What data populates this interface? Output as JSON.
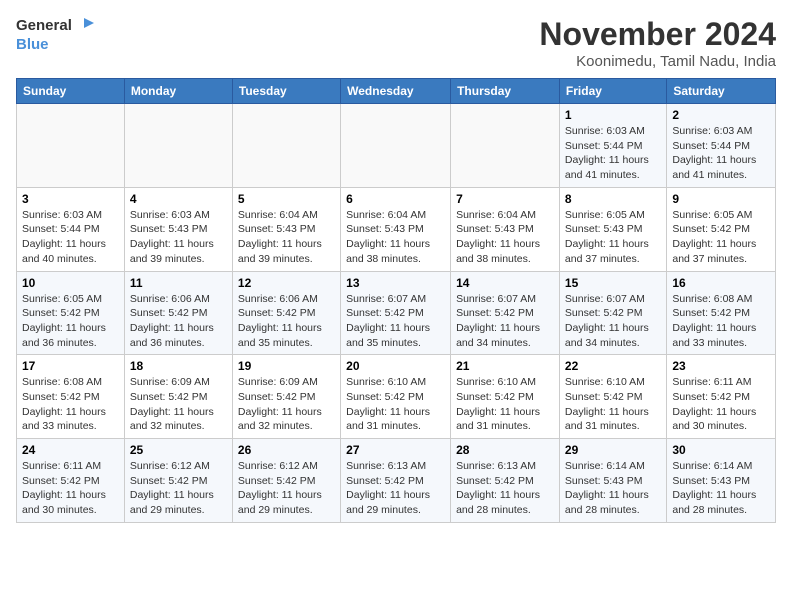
{
  "logo": {
    "text_general": "General",
    "text_blue": "Blue"
  },
  "header": {
    "month_year": "November 2024",
    "location": "Koonimedu, Tamil Nadu, India"
  },
  "weekdays": [
    "Sunday",
    "Monday",
    "Tuesday",
    "Wednesday",
    "Thursday",
    "Friday",
    "Saturday"
  ],
  "weeks": [
    [
      {
        "day": "",
        "info": ""
      },
      {
        "day": "",
        "info": ""
      },
      {
        "day": "",
        "info": ""
      },
      {
        "day": "",
        "info": ""
      },
      {
        "day": "",
        "info": ""
      },
      {
        "day": "1",
        "info": "Sunrise: 6:03 AM\nSunset: 5:44 PM\nDaylight: 11 hours and 41 minutes."
      },
      {
        "day": "2",
        "info": "Sunrise: 6:03 AM\nSunset: 5:44 PM\nDaylight: 11 hours and 41 minutes."
      }
    ],
    [
      {
        "day": "3",
        "info": "Sunrise: 6:03 AM\nSunset: 5:44 PM\nDaylight: 11 hours and 40 minutes."
      },
      {
        "day": "4",
        "info": "Sunrise: 6:03 AM\nSunset: 5:43 PM\nDaylight: 11 hours and 39 minutes."
      },
      {
        "day": "5",
        "info": "Sunrise: 6:04 AM\nSunset: 5:43 PM\nDaylight: 11 hours and 39 minutes."
      },
      {
        "day": "6",
        "info": "Sunrise: 6:04 AM\nSunset: 5:43 PM\nDaylight: 11 hours and 38 minutes."
      },
      {
        "day": "7",
        "info": "Sunrise: 6:04 AM\nSunset: 5:43 PM\nDaylight: 11 hours and 38 minutes."
      },
      {
        "day": "8",
        "info": "Sunrise: 6:05 AM\nSunset: 5:43 PM\nDaylight: 11 hours and 37 minutes."
      },
      {
        "day": "9",
        "info": "Sunrise: 6:05 AM\nSunset: 5:42 PM\nDaylight: 11 hours and 37 minutes."
      }
    ],
    [
      {
        "day": "10",
        "info": "Sunrise: 6:05 AM\nSunset: 5:42 PM\nDaylight: 11 hours and 36 minutes."
      },
      {
        "day": "11",
        "info": "Sunrise: 6:06 AM\nSunset: 5:42 PM\nDaylight: 11 hours and 36 minutes."
      },
      {
        "day": "12",
        "info": "Sunrise: 6:06 AM\nSunset: 5:42 PM\nDaylight: 11 hours and 35 minutes."
      },
      {
        "day": "13",
        "info": "Sunrise: 6:07 AM\nSunset: 5:42 PM\nDaylight: 11 hours and 35 minutes."
      },
      {
        "day": "14",
        "info": "Sunrise: 6:07 AM\nSunset: 5:42 PM\nDaylight: 11 hours and 34 minutes."
      },
      {
        "day": "15",
        "info": "Sunrise: 6:07 AM\nSunset: 5:42 PM\nDaylight: 11 hours and 34 minutes."
      },
      {
        "day": "16",
        "info": "Sunrise: 6:08 AM\nSunset: 5:42 PM\nDaylight: 11 hours and 33 minutes."
      }
    ],
    [
      {
        "day": "17",
        "info": "Sunrise: 6:08 AM\nSunset: 5:42 PM\nDaylight: 11 hours and 33 minutes."
      },
      {
        "day": "18",
        "info": "Sunrise: 6:09 AM\nSunset: 5:42 PM\nDaylight: 11 hours and 32 minutes."
      },
      {
        "day": "19",
        "info": "Sunrise: 6:09 AM\nSunset: 5:42 PM\nDaylight: 11 hours and 32 minutes."
      },
      {
        "day": "20",
        "info": "Sunrise: 6:10 AM\nSunset: 5:42 PM\nDaylight: 11 hours and 31 minutes."
      },
      {
        "day": "21",
        "info": "Sunrise: 6:10 AM\nSunset: 5:42 PM\nDaylight: 11 hours and 31 minutes."
      },
      {
        "day": "22",
        "info": "Sunrise: 6:10 AM\nSunset: 5:42 PM\nDaylight: 11 hours and 31 minutes."
      },
      {
        "day": "23",
        "info": "Sunrise: 6:11 AM\nSunset: 5:42 PM\nDaylight: 11 hours and 30 minutes."
      }
    ],
    [
      {
        "day": "24",
        "info": "Sunrise: 6:11 AM\nSunset: 5:42 PM\nDaylight: 11 hours and 30 minutes."
      },
      {
        "day": "25",
        "info": "Sunrise: 6:12 AM\nSunset: 5:42 PM\nDaylight: 11 hours and 29 minutes."
      },
      {
        "day": "26",
        "info": "Sunrise: 6:12 AM\nSunset: 5:42 PM\nDaylight: 11 hours and 29 minutes."
      },
      {
        "day": "27",
        "info": "Sunrise: 6:13 AM\nSunset: 5:42 PM\nDaylight: 11 hours and 29 minutes."
      },
      {
        "day": "28",
        "info": "Sunrise: 6:13 AM\nSunset: 5:42 PM\nDaylight: 11 hours and 28 minutes."
      },
      {
        "day": "29",
        "info": "Sunrise: 6:14 AM\nSunset: 5:43 PM\nDaylight: 11 hours and 28 minutes."
      },
      {
        "day": "30",
        "info": "Sunrise: 6:14 AM\nSunset: 5:43 PM\nDaylight: 11 hours and 28 minutes."
      }
    ]
  ]
}
